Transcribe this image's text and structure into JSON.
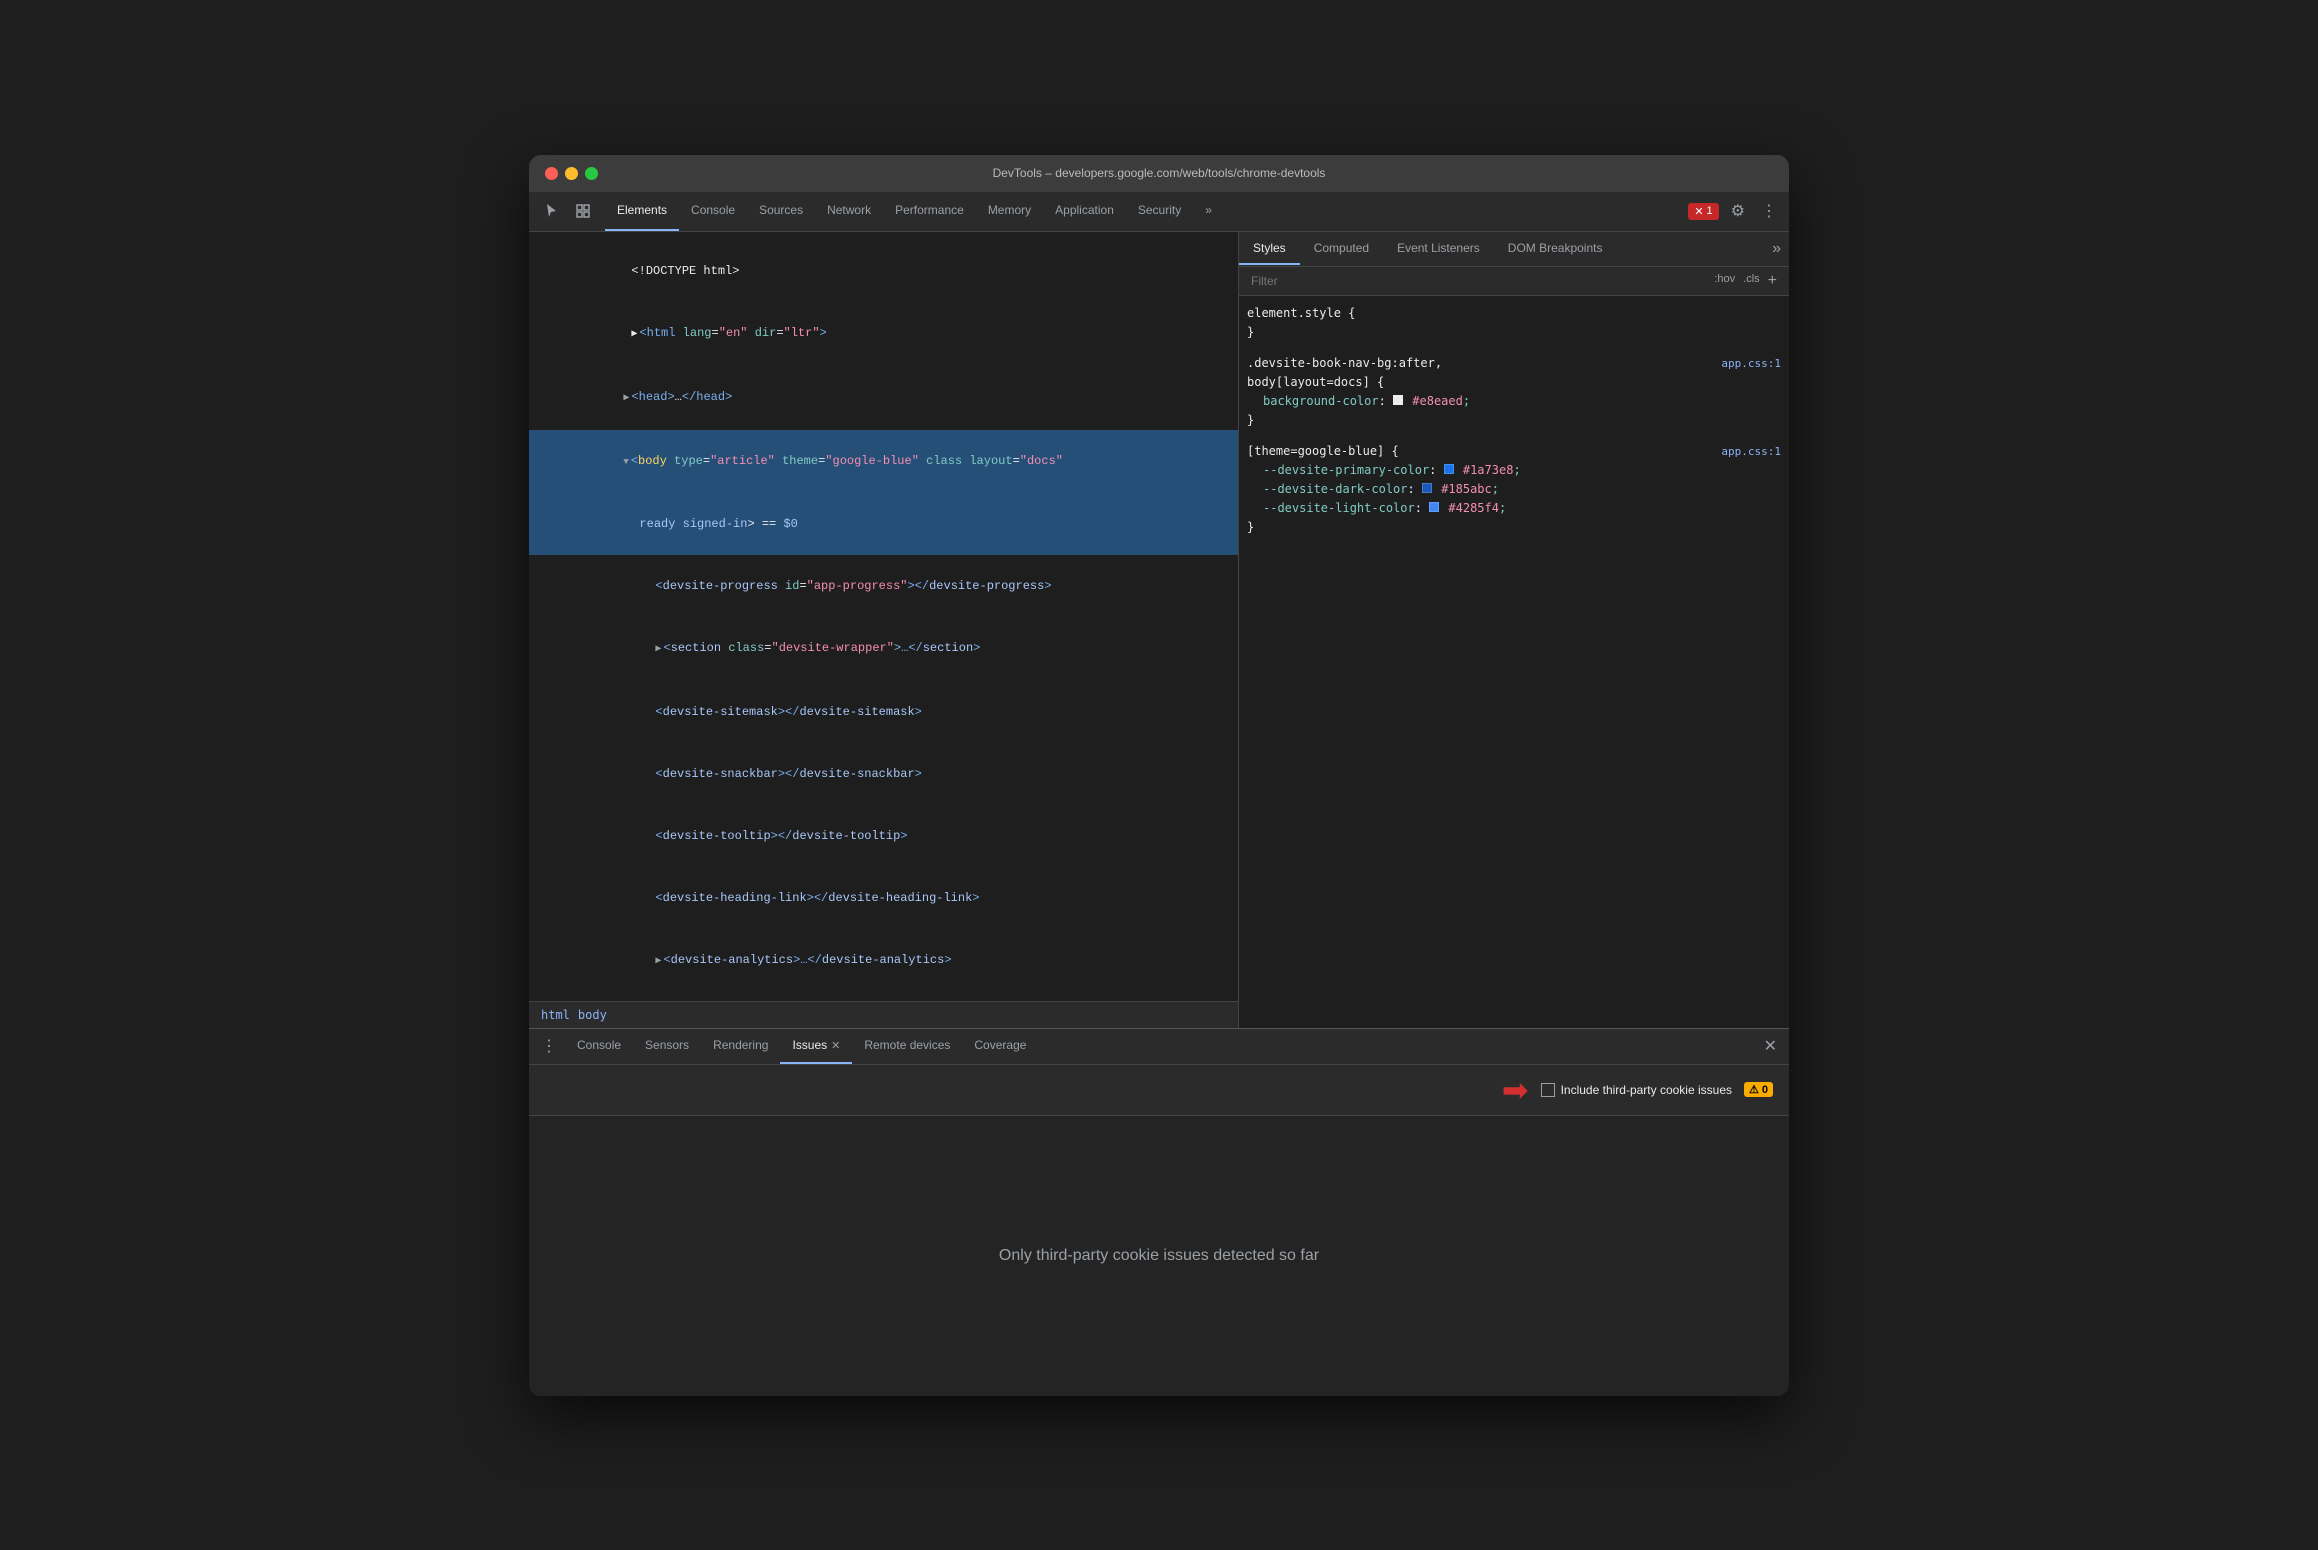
{
  "window": {
    "titlebar_title": "DevTools – developers.google.com/web/tools/chrome-devtools"
  },
  "toolbar": {
    "tabs": [
      {
        "label": "Elements",
        "active": true
      },
      {
        "label": "Console",
        "active": false
      },
      {
        "label": "Sources",
        "active": false
      },
      {
        "label": "Network",
        "active": false
      },
      {
        "label": "Performance",
        "active": false
      },
      {
        "label": "Memory",
        "active": false
      },
      {
        "label": "Application",
        "active": false
      },
      {
        "label": "Security",
        "active": false
      }
    ],
    "more_tabs_label": "»",
    "error_count": "1",
    "error_icon": "✕"
  },
  "dom_panel": {
    "lines": [
      {
        "text": "<!DOCTYPE html>",
        "type": "doctype",
        "indent": 0
      },
      {
        "text": "<html lang=\"en\" dir=\"ltr\">",
        "type": "tag",
        "indent": 0
      },
      {
        "text": "▶ <head>…</head>",
        "type": "collapsed",
        "indent": 1
      },
      {
        "text": "<body type=\"article\" theme=\"google-blue\" class layout=\"docs\"",
        "type": "body-open",
        "indent": 1,
        "selected": true
      },
      {
        "text": "ready signed-in> == $0",
        "type": "body-cont",
        "indent": 2,
        "selected": true
      },
      {
        "text": "<devsite-progress id=\"app-progress\"></devsite-progress>",
        "type": "tag",
        "indent": 3
      },
      {
        "text": "▶ <section class=\"devsite-wrapper\">…</section>",
        "type": "collapsed",
        "indent": 3
      },
      {
        "text": "<devsite-sitemask></devsite-sitemask>",
        "type": "tag",
        "indent": 3
      },
      {
        "text": "<devsite-snackbar></devsite-snackbar>",
        "type": "tag",
        "indent": 3
      },
      {
        "text": "<devsite-tooltip></devsite-tooltip>",
        "type": "tag",
        "indent": 3
      },
      {
        "text": "<devsite-heading-link></devsite-heading-link>",
        "type": "tag",
        "indent": 3
      },
      {
        "text": "▶ <devsite-analytics>…</devsite-analytics>",
        "type": "collapsed-analytics",
        "indent": 3
      }
    ],
    "breadcrumb": [
      "html",
      "body"
    ]
  },
  "styles_panel": {
    "tabs": [
      {
        "label": "Styles",
        "active": true
      },
      {
        "label": "Computed",
        "active": false
      },
      {
        "label": "Event Listeners",
        "active": false
      },
      {
        "label": "DOM Breakpoints",
        "active": false
      }
    ],
    "filter_placeholder": "Filter",
    "filter_actions": [
      ":hov",
      ".cls",
      "+"
    ],
    "rules": [
      {
        "selector": "element.style {",
        "close": "}",
        "props": [],
        "source": ""
      },
      {
        "selector": ".devsite-book-nav-bg:after,",
        "selector2": "body[layout=docs] {",
        "close": "}",
        "props": [
          {
            "name": "background-color:",
            "value": "#e8eaed",
            "color": "#e8eaed"
          }
        ],
        "source": "app.css:1"
      },
      {
        "selector": "[theme=google-blue] {",
        "close": "}",
        "props": [
          {
            "name": "--devsite-primary-color:",
            "value": "#1a73e8",
            "color": "#1a73e8"
          },
          {
            "name": "--devsite-dark-color:",
            "value": "#185abc",
            "color": "#185abc"
          },
          {
            "name": "--devsite-light-color:",
            "value": "#4285f4",
            "color": "#4285f4"
          }
        ],
        "source": "app.css:1"
      }
    ]
  },
  "drawer": {
    "tabs": [
      {
        "label": "Console",
        "active": false,
        "closeable": false
      },
      {
        "label": "Sensors",
        "active": false,
        "closeable": false
      },
      {
        "label": "Rendering",
        "active": false,
        "closeable": false
      },
      {
        "label": "Issues",
        "active": true,
        "closeable": true
      },
      {
        "label": "Remote devices",
        "active": false,
        "closeable": false
      },
      {
        "label": "Coverage",
        "active": false,
        "closeable": false
      }
    ],
    "checkbox_label": "Include third-party cookie issues",
    "warning_count": "0",
    "empty_message": "Only third-party cookie issues detected so far"
  }
}
